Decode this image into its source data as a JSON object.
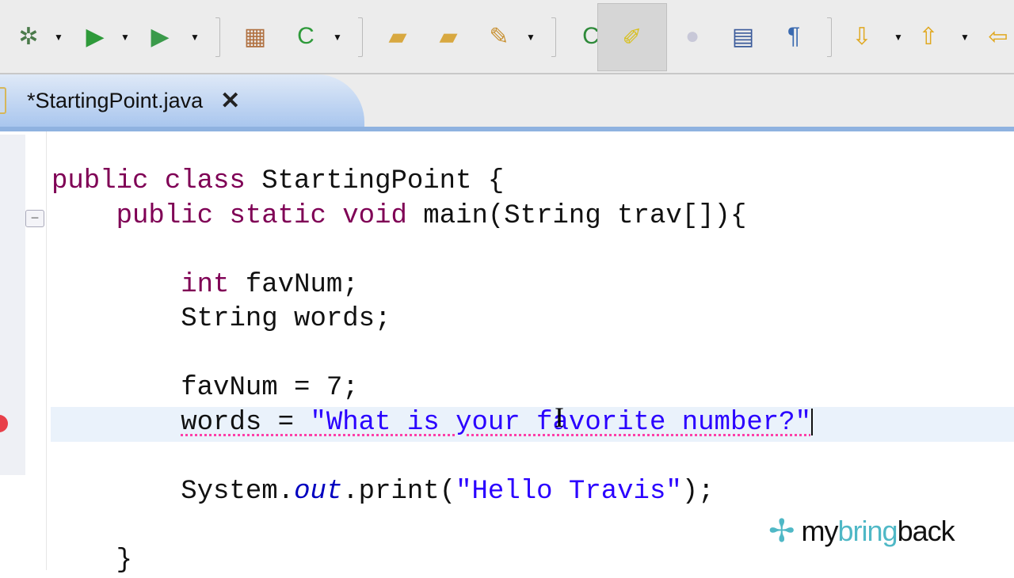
{
  "toolbar": {
    "buttons": [
      {
        "name": "debug-icon",
        "glyph": "✲",
        "color": "#4a7a4a"
      },
      {
        "name": "run-icon",
        "glyph": "▶",
        "color": "#2e9a3a"
      },
      {
        "name": "run-external-tools-icon",
        "glyph": "▶",
        "color": "#3a9a4a"
      },
      {
        "name": "new-java-package-icon",
        "glyph": "▦",
        "color": "#b07040"
      },
      {
        "name": "new-java-class-icon",
        "glyph": "C",
        "color": "#2e9a3a"
      },
      {
        "name": "open-type-icon",
        "glyph": "▰",
        "color": "#d8a840"
      },
      {
        "name": "open-task-icon",
        "glyph": "▰",
        "color": "#d8a840"
      },
      {
        "name": "search-icon",
        "glyph": "✎",
        "color": "#c89030"
      },
      {
        "name": "toggle-breadcrumb-icon",
        "glyph": "C",
        "color": "#2e8a3a"
      },
      {
        "name": "mark-occurrences-icon",
        "glyph": "✐",
        "color": "#d8c020"
      },
      {
        "name": "toggle-block-selection-icon",
        "glyph": "●",
        "color": "#c8c8d8"
      },
      {
        "name": "show-source-icon",
        "glyph": "▤",
        "color": "#3a5a9a"
      },
      {
        "name": "show-whitespace-icon",
        "glyph": "¶",
        "color": "#3a6ab0"
      },
      {
        "name": "next-annotation-icon",
        "glyph": "⇩",
        "color": "#e0a820"
      },
      {
        "name": "previous-annotation-icon",
        "glyph": "⇧",
        "color": "#e0a820"
      },
      {
        "name": "last-edit-location-icon",
        "glyph": "⇦",
        "color": "#e0a820"
      }
    ]
  },
  "editor_tab": {
    "title": "*StartingPoint.java",
    "close": "✕"
  },
  "code": {
    "l1_kw": "public class",
    "l1_rest": " StartingPoint {",
    "l2_kw": "public static void",
    "l2_rest": " main(String trav[]){",
    "l4_kw": "int",
    "l4_rest": " favNum;",
    "l5": "String words;",
    "l7": "favNum = 7;",
    "l8_pre": "words = ",
    "l8_str": "\"What is your favorite number?\"",
    "l10_pre": "System.",
    "l10_field": "out",
    "l10_mid": ".print(",
    "l10_str": "\"Hello Travis\"",
    "l10_end": ");",
    "l12": "}"
  },
  "watermark": {
    "pre": "my",
    "mid": "bring",
    "post": "back"
  }
}
